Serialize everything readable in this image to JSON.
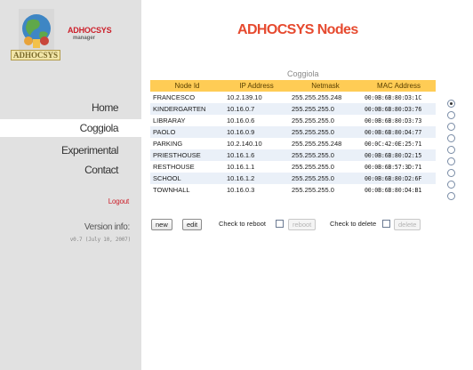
{
  "app": {
    "logo_brand": "ADHOCSYS",
    "logo_sub": "manager",
    "logo_name": "ADHOCSYS"
  },
  "sidebar": {
    "items": [
      {
        "label": "Home"
      },
      {
        "label": "Coggiola",
        "active": true
      },
      {
        "label": "Experimental"
      },
      {
        "label": "Contact"
      }
    ],
    "logout_label": "Logout",
    "version_label": "Version info:",
    "version_value": "v0.7 (July 10, 2007)"
  },
  "main": {
    "title": "ADHOCSYS Nodes",
    "table_caption": "Coggiola",
    "columns": [
      "Node Id",
      "IP Address",
      "Netmask",
      "MAC Address"
    ],
    "rows": [
      {
        "node_id": "FRANCESCO",
        "ip": "10.2.139.10",
        "netmask": "255.255.255.248",
        "mac": "00:0B:6B:80:D3:1C",
        "selected": true
      },
      {
        "node_id": "KINDERGARTEN",
        "ip": "10.16.0.7",
        "netmask": "255.255.255.0",
        "mac": "00:0B:6B:80:D3:76",
        "selected": false
      },
      {
        "node_id": "LIBRARAY",
        "ip": "10.16.0.6",
        "netmask": "255.255.255.0",
        "mac": "00:0B:6B:80:D3:73",
        "selected": false
      },
      {
        "node_id": "PAOLO",
        "ip": "10.16.0.9",
        "netmask": "255.255.255.0",
        "mac": "00:0B:6B:80:D4:77",
        "selected": false
      },
      {
        "node_id": "PARKING",
        "ip": "10.2.140.10",
        "netmask": "255.255.255.248",
        "mac": "00:0C:42:0E:25:71",
        "selected": false
      },
      {
        "node_id": "PRIESTHOUSE",
        "ip": "10.16.1.6",
        "netmask": "255.255.255.0",
        "mac": "00:0B:6B:80:D2:15",
        "selected": false
      },
      {
        "node_id": "RESTHOUSE",
        "ip": "10.16.1.1",
        "netmask": "255.255.255.0",
        "mac": "00:0B:6B:57:3D:71",
        "selected": false
      },
      {
        "node_id": "SCHOOL",
        "ip": "10.16.1.2",
        "netmask": "255.255.255.0",
        "mac": "00:0B:6B:80:D2:6F",
        "selected": false
      },
      {
        "node_id": "TOWNHALL",
        "ip": "10.16.0.3",
        "netmask": "255.255.255.0",
        "mac": "00:0B:6B:80:D4:B1",
        "selected": false
      }
    ],
    "actions": {
      "new_label": "new",
      "edit_label": "edit",
      "reboot_check_label": "Check to reboot",
      "reboot_label": "reboot",
      "delete_check_label": "Check to delete",
      "delete_label": "delete"
    }
  },
  "colors": {
    "accent": "#e64a2f",
    "header_bg": "#ffcc55",
    "sidebar_bg": "#e1e1e1",
    "alt_row_bg": "#eaf0f8",
    "logout": "#cc1f2a"
  }
}
